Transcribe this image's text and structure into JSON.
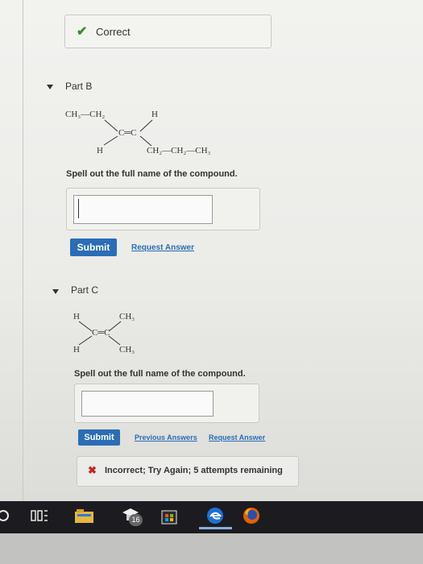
{
  "feedback_correct": {
    "text": "Correct"
  },
  "part_b": {
    "title": "Part B",
    "structure": {
      "top_left": "CH₃—CH₂",
      "top_right": "H",
      "center": "C═C",
      "bottom_left": "H",
      "bottom_right": "CH₂—CH₂—CH₃"
    },
    "prompt": "Spell out the full name of the compound.",
    "answer_value": "",
    "submit_label": "Submit",
    "request_answer_label": "Request Answer"
  },
  "part_c": {
    "title": "Part C",
    "structure": {
      "top_left": "H",
      "top_right": "CH₃",
      "center": "C═C",
      "bottom_left": "H",
      "bottom_right": "CH₃"
    },
    "prompt": "Spell out the full name of the compound.",
    "answer_value": "",
    "submit_label": "Submit",
    "previous_answers_label": "Previous Answers",
    "request_answer_label": "Request Answer"
  },
  "feedback_incorrect": {
    "text": "Incorrect; Try Again; 5 attempts remaining"
  },
  "taskbar": {
    "badge_count": "16",
    "icons": [
      "power-icon",
      "task-view-icon",
      "file-explorer-icon",
      "store-bag-icon",
      "mortarboard-icon",
      "store-icon",
      "edge-icon",
      "firefox-icon"
    ]
  },
  "colors": {
    "accent": "#2a6db5",
    "correct": "#3b8e2e",
    "incorrect": "#c62828"
  }
}
